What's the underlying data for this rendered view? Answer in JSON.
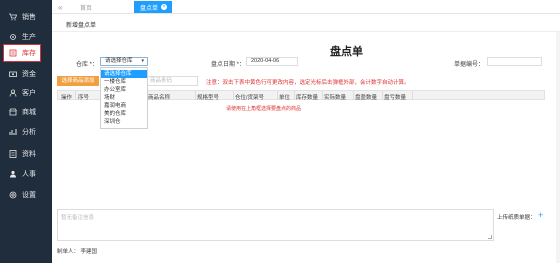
{
  "sidebar": {
    "items": [
      {
        "label": "销售",
        "icon": "cart-icon"
      },
      {
        "label": "生产",
        "icon": "gear-icon"
      },
      {
        "label": "库存",
        "icon": "inventory-icon"
      },
      {
        "label": "资金",
        "icon": "money-icon"
      },
      {
        "label": "客户",
        "icon": "user-icon"
      },
      {
        "label": "商城",
        "icon": "shop-icon"
      },
      {
        "label": "分析",
        "icon": "chart-icon"
      },
      {
        "label": "资料",
        "icon": "list-icon"
      },
      {
        "label": "人事",
        "icon": "person-icon"
      },
      {
        "label": "设置",
        "icon": "settings-icon"
      }
    ],
    "active_index": 2
  },
  "topbar": {
    "collapse": "«",
    "home_tab": "首页",
    "active_tab": "盘点单",
    "close": "×"
  },
  "subhead": "新增盘点单",
  "form": {
    "title": "盘点单",
    "warehouse_label": "仓库 *：",
    "warehouse_value": "请选择仓库",
    "date_label": "盘点日期 *：",
    "date_value": "2020-04-06",
    "bill_label": "单据编号："
  },
  "toolbar": {
    "add_button": "选择商品添加",
    "scan_placeholder": "商品条码",
    "notice": "注意：双击下表中黄色行可更改内容，选定光标后击弹框外部，会计数字自动计算。"
  },
  "table": {
    "headers": [
      "操作",
      "序号",
      "商品名称",
      "规格型号",
      "仓位/货架号",
      "单位",
      "库存数量",
      "实际数量",
      "盘盈数量",
      "盘亏数量"
    ],
    "empty_tip": "请使用在上角框选择要盘点的商品"
  },
  "dropdown": {
    "options": [
      "请选择仓库",
      "一楼仓库",
      "办公室库",
      "场财",
      "嘉润电商",
      "美的仓库",
      "深圳仓"
    ],
    "selected_index": 0
  },
  "remark_placeholder": "暂无备注信息",
  "upload_label": "上传纸质单据：",
  "upload_plus": "+",
  "maker_label": "制单人：",
  "maker_value": "李建国"
}
